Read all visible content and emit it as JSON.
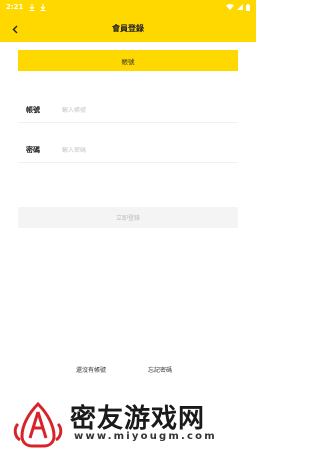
{
  "status_bar": {
    "time": "2:21"
  },
  "header": {
    "title": "會員登錄"
  },
  "tab": {
    "label": "帳號"
  },
  "fields": [
    {
      "label": "帳號",
      "placeholder": "輸入帳號"
    },
    {
      "label": "密碼",
      "placeholder": "輸入密碼"
    }
  ],
  "submit_label": "立即登錄",
  "links": {
    "register": "還沒有帳號",
    "forgot": "忘記密碼"
  },
  "watermark": {
    "brand": "密友游戏网",
    "url": "www.miyougm.com"
  },
  "colors": {
    "accent": "#FFD800",
    "logo_red": "#D8232A"
  }
}
